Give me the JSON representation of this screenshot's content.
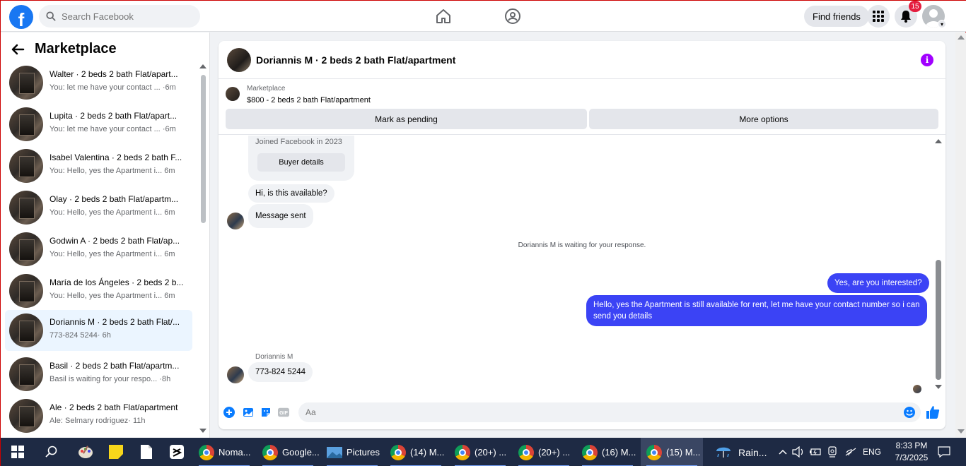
{
  "topbar": {
    "logo": "f",
    "search_placeholder": "Search Facebook",
    "find_friends": "Find friends",
    "notification_count": "15"
  },
  "sidebar": {
    "title": "Marketplace",
    "conversations": [
      {
        "name": "Walter · 2 beds 2 bath Flat/apart...",
        "preview": "You: let me have your contact ...",
        "time": "·6m"
      },
      {
        "name": "Lupita · 2 beds 2 bath Flat/apart...",
        "preview": "You: let me have your contact ...",
        "time": "·6m"
      },
      {
        "name": "Isabel Valentina · 2 beds 2 bath F...",
        "preview": "You: Hello, yes the Apartment i...",
        "time": "6m"
      },
      {
        "name": "Olay · 2 beds 2 bath Flat/apartm...",
        "preview": "You: Hello, yes the Apartment i...",
        "time": "6m"
      },
      {
        "name": "Godwin A · 2 beds 2 bath Flat/ap...",
        "preview": "You: Hello, yes the Apartment i...",
        "time": "6m"
      },
      {
        "name": "María de los Ángeles · 2 beds 2 b...",
        "preview": "You: Hello, yes the Apartment i...",
        "time": "6m"
      },
      {
        "name": "Doriannis M · 2 beds 2 bath Flat/...",
        "preview": "773-824 5244",
        "time": "· 6h"
      },
      {
        "name": "Basil · 2 beds 2 bath Flat/apartm...",
        "preview": "Basil is waiting for your respo...",
        "time": "·8h"
      },
      {
        "name": "Ale · 2 beds 2 bath Flat/apartment",
        "preview": "Ale: Selmary rodriguez",
        "time": "· 11h"
      }
    ]
  },
  "chat": {
    "title": "Doriannis M · 2 beds 2 bath Flat/apartment",
    "listing_label": "Marketplace",
    "listing_price": "$800 - 2 beds 2 bath Flat/apartment",
    "mark_pending": "Mark as pending",
    "more_options": "More options",
    "joined": "Joined Facebook in 2023",
    "buyer_details": "Buyer details",
    "msg_available": "Hi, is this available?",
    "msg_sent": "Message sent",
    "waiting": "Doriannis M is waiting for your response.",
    "out_1": "Yes, are you interested?",
    "out_2": "Hello, yes the Apartment is still available for rent, let me have your contact number so i can send you details",
    "sender": "Doriannis M",
    "in_phone": "773-824 5244",
    "composer_placeholder": "Aa"
  },
  "taskbar": {
    "apps": [
      {
        "label": "Noma..."
      },
      {
        "label": "Google..."
      },
      {
        "label": "Pictures"
      },
      {
        "label": "(14) M..."
      },
      {
        "label": "(20+) ..."
      },
      {
        "label": "(20+) ..."
      },
      {
        "label": "(16) M..."
      },
      {
        "label": "(15) M..."
      }
    ],
    "weather": "Rain...",
    "language": "ENG",
    "time": "8:33 PM",
    "date": "7/3/2025"
  }
}
